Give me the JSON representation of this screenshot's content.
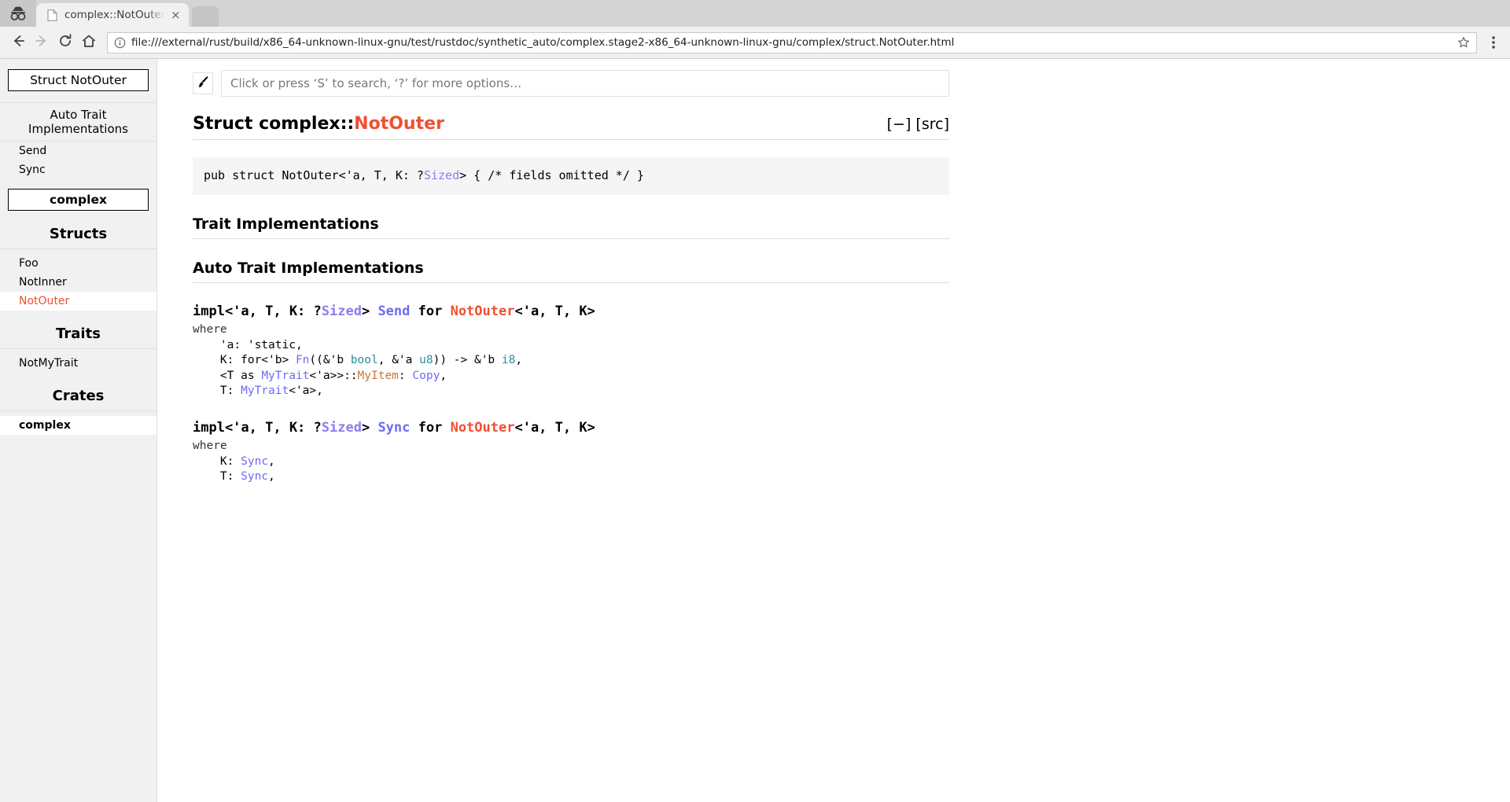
{
  "browser": {
    "incognito_icon": "incognito-icon",
    "tab": {
      "favicon": "page-icon",
      "title": "complex::NotOuter",
      "close_label": "×"
    },
    "new_tab_label": "",
    "nav": {
      "back_icon": "back-arrow-icon",
      "forward_icon": "forward-arrow-icon",
      "reload_icon": "reload-icon",
      "home_icon": "home-icon"
    },
    "omnibox": {
      "info_icon": "page-info-icon",
      "url": "file:///external/rust/build/x86_64-unknown-linux-gnu/test/rustdoc/synthetic_auto/complex.stage2-x86_64-unknown-linux-gnu/complex/struct.NotOuter.html",
      "star_icon": "bookmark-star-icon"
    },
    "menu_icon": "three-dot-menu-icon"
  },
  "sidebar": {
    "location": {
      "label": "Struct NotOuter",
      "bold": false
    },
    "blocks": [
      {
        "title": "Auto Trait Implementations",
        "items": [
          {
            "label": "Send",
            "current": false
          },
          {
            "label": "Sync",
            "current": false
          }
        ]
      }
    ],
    "crate_location": {
      "label": "complex",
      "bold": true
    },
    "sections": [
      {
        "heading": "Structs",
        "items": [
          {
            "label": "Foo",
            "current": false
          },
          {
            "label": "NotInner",
            "current": false
          },
          {
            "label": "NotOuter",
            "current": true
          }
        ]
      },
      {
        "heading": "Traits",
        "items": [
          {
            "label": "NotMyTrait",
            "current": false
          }
        ]
      },
      {
        "heading": "Crates",
        "items": [
          {
            "label": "complex",
            "current": false,
            "crate": true
          }
        ]
      }
    ]
  },
  "main": {
    "theme_picker_icon": "paintbrush-icon",
    "search": {
      "placeholder": "Click or press ‘S’ to search, ‘?’ for more options…",
      "value": ""
    },
    "title": {
      "prefix": "Struct ",
      "path": "complex::",
      "name": "NotOuter"
    },
    "header_links": {
      "collapse": "[−]",
      "src": "[src]"
    },
    "declaration": {
      "before": "pub struct NotOuter<'a, T, K: ?",
      "sized": "Sized",
      "after": "> { /* fields omitted */ }"
    },
    "sections": [
      {
        "heading": "Trait Implementations"
      },
      {
        "heading": "Auto Trait Implementations"
      }
    ],
    "impls": [
      {
        "id": "impl-send",
        "prefix": "impl<'a, T, K: ?",
        "sized": "Sized",
        "mid": "> ",
        "trait_name": "Send",
        "for_word": " for ",
        "type_name": "NotOuter",
        "generics": "<'a, T, K>",
        "where_keyword": "where",
        "bounds": [
          {
            "text": "    'a: 'static,"
          },
          {
            "text": "    K: for<'b> Fn((&'b bool, &'a u8)) -> &'b i8,"
          },
          {
            "text": "    <T as MyTrait<'a>>::MyItem: Copy,"
          },
          {
            "text": "    T: MyTrait<'a>,"
          }
        ]
      },
      {
        "id": "impl-sync",
        "prefix": "impl<'a, T, K: ?",
        "sized": "Sized",
        "mid": "> ",
        "trait_name": "Sync",
        "for_word": " for ",
        "type_name": "NotOuter",
        "generics": "<'a, T, K>",
        "where_keyword": "where",
        "bounds": [
          {
            "text": "    K: Sync,"
          },
          {
            "text": "    T: Sync,"
          }
        ]
      }
    ]
  },
  "colors": {
    "struct_red": "#ef5032",
    "trait_blue": "#6e6bf0",
    "sized_purple": "#8a7ef0",
    "primitive_teal": "#2b8e9c",
    "assoc_orange": "#c8763a",
    "sidebar_bg": "#f1f1f1",
    "code_bg": "#f5f5f5"
  }
}
